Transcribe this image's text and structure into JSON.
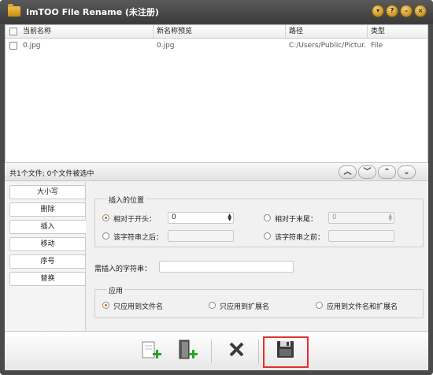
{
  "window": {
    "title": "ImTOO File Rename (未注册)"
  },
  "window_buttons": [
    "chevron-down-icon",
    "help-icon",
    "minimize-icon",
    "close-icon"
  ],
  "file_list": {
    "columns": [
      "当前名称",
      "新名称预览",
      "路径",
      "类型"
    ],
    "rows": [
      {
        "current_name": "0.jpg",
        "new_name": "0.jpg",
        "path": "C:/Users/Public/Pictur...",
        "type": "File"
      }
    ]
  },
  "status": {
    "text": "共1个文件; 0个文件被选中"
  },
  "nav_buttons": [
    "move-up-icon",
    "move-down-icon",
    "move-top-icon",
    "move-bottom-icon"
  ],
  "sidebar": {
    "items": [
      {
        "label": "大小写"
      },
      {
        "label": "删除"
      },
      {
        "label": "插入"
      },
      {
        "label": "移动"
      },
      {
        "label": "序号"
      },
      {
        "label": "替换"
      }
    ],
    "selected": "插入"
  },
  "insert_position": {
    "title": "插入的位置",
    "from_start_label": "相对于开头：",
    "from_start_value": "0",
    "from_end_label": "相对于末尾：",
    "from_end_value": "0",
    "after_label": "该字符串之后：",
    "before_label": "该字符串之前：",
    "selected": "相对于开头："
  },
  "insert_string": {
    "label": "需插入的字符串：",
    "value": ""
  },
  "apply": {
    "title": "应用",
    "options": [
      "只应用到文件名",
      "只应用到扩展名",
      "应用到文件名和扩展名"
    ],
    "selected": "只应用到文件名"
  },
  "toolbar": {
    "buttons": [
      "add-files-icon",
      "add-folder-icon",
      "clear-icon",
      "save-icon"
    ],
    "highlight_color": "#e33030"
  }
}
